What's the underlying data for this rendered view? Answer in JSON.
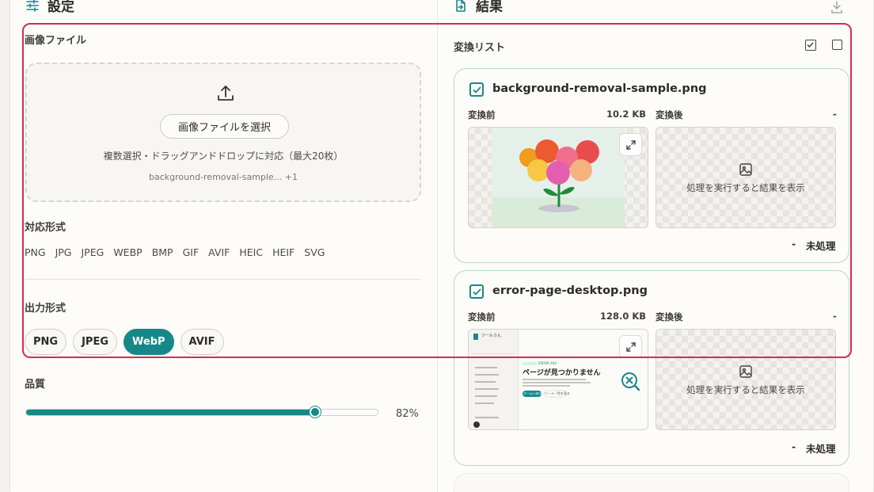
{
  "settings": {
    "title": "設定",
    "image_file_label": "画像ファイル",
    "select_button": "画像ファイルを選択",
    "dropzone_note": "複数選択・ドラッグアンドドロップに対応（最大20枚）",
    "selected_files": "background-removal-sample... +1",
    "supported_label": "対応形式",
    "supported_formats": [
      "PNG",
      "JPG",
      "JPEG",
      "WEBP",
      "BMP",
      "GIF",
      "AVIF",
      "HEIC",
      "HEIF",
      "SVG"
    ],
    "output_label": "出力形式",
    "output_formats": [
      "PNG",
      "JPEG",
      "WebP",
      "AVIF"
    ],
    "output_selected": "WebP",
    "quality_label": "品質",
    "quality_value": 82,
    "quality_text": "82%"
  },
  "results": {
    "title": "結果",
    "list_label": "変換リスト",
    "cards": [
      {
        "name": "background-removal-sample.png",
        "checked": true,
        "before_label": "変換前",
        "before_size": "10.2 KB",
        "after_label": "変換後",
        "after_size": "-",
        "after_placeholder": "処理を実行すると結果を表示",
        "status_size": "-",
        "status": "未処理"
      },
      {
        "name": "error-page-desktop.png",
        "checked": true,
        "before_label": "変換前",
        "before_size": "128.0 KB",
        "after_label": "変換後",
        "after_size": "-",
        "after_placeholder": "処理を実行すると結果を表示",
        "status_size": "-",
        "status": "未処理"
      }
    ]
  },
  "colors": {
    "accent": "#17888a",
    "highlight_border": "#d42b5a"
  },
  "thumb2": {
    "brand": "ツールさん",
    "heading": "ページが見つかりません",
    "tag": "ERROR 404",
    "home_btn": "ホームへ戻る",
    "tools_link": "ツール一覧を見る"
  }
}
